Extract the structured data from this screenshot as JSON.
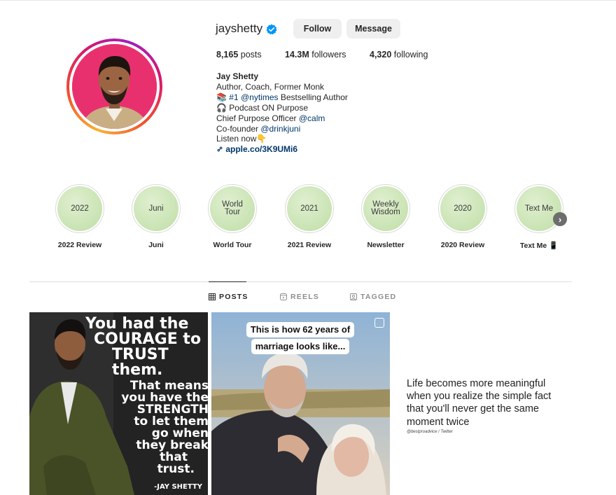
{
  "profile": {
    "username": "jayshetty",
    "verified": true,
    "follow_label": "Follow",
    "message_label": "Message",
    "stats": {
      "posts_count": "8,165",
      "posts_label": "posts",
      "followers_count": "14.3M",
      "followers_label": "followers",
      "following_count": "4,320",
      "following_label": "following"
    },
    "bio": {
      "name": "Jay Shetty",
      "line1": "Author, Coach, Former Monk",
      "line2_icon": "📚",
      "line2_mention": "#1 @nytimes",
      "line2_text": " Bestselling Author",
      "line3_icon": "🎧",
      "line3_text": " Podcast ON Purpose",
      "line4_text": "Chief Purpose Officer ",
      "line4_mention": "@calm",
      "line5_text": "Co-founder ",
      "line5_mention": "@drinkjuni",
      "line6_text": "Listen now",
      "line6_icon": "👇",
      "link": "apple.co/3K9UMi6"
    }
  },
  "highlights": [
    {
      "cover": "2022",
      "label": "2022 Review"
    },
    {
      "cover": "Juni",
      "label": "Juni"
    },
    {
      "cover": "World Tour",
      "label": "World Tour"
    },
    {
      "cover": "2021",
      "label": "2021 Review"
    },
    {
      "cover": "Weekly Wisdom",
      "label": "Newsletter"
    },
    {
      "cover": "2020",
      "label": "2020 Review"
    },
    {
      "cover": "Text Me",
      "label": "Text Me 📱"
    }
  ],
  "tabs": [
    {
      "label": "POSTS",
      "icon": "grid-icon",
      "active": true
    },
    {
      "label": "REELS",
      "icon": "reels-icon",
      "active": false
    },
    {
      "label": "TAGGED",
      "icon": "tagged-icon",
      "active": false
    }
  ],
  "posts": {
    "post1": {
      "lines": [
        "You had the",
        "COURAGE to",
        "TRUST them.",
        "That means",
        "you have the",
        "STRENGTH",
        "to let them",
        "go when",
        "they break",
        "that",
        "trust."
      ],
      "signature": "-JAY SHETTY"
    },
    "post2": {
      "caption_line1": "This is how 62 years of",
      "caption_line2": "marriage looks like..."
    },
    "post3": {
      "quote": "Life becomes more meaningful when you realize the simple fact that you'll never get the same moment twice",
      "credit": "@bestproadvice / Twitter"
    }
  },
  "colors": {
    "text": "#262626",
    "link": "#00376b",
    "verified": "#0095f6",
    "button_bg": "#efefef",
    "highlight_bg": "#c9e3b3",
    "avatar_bg": "#e9306f"
  }
}
